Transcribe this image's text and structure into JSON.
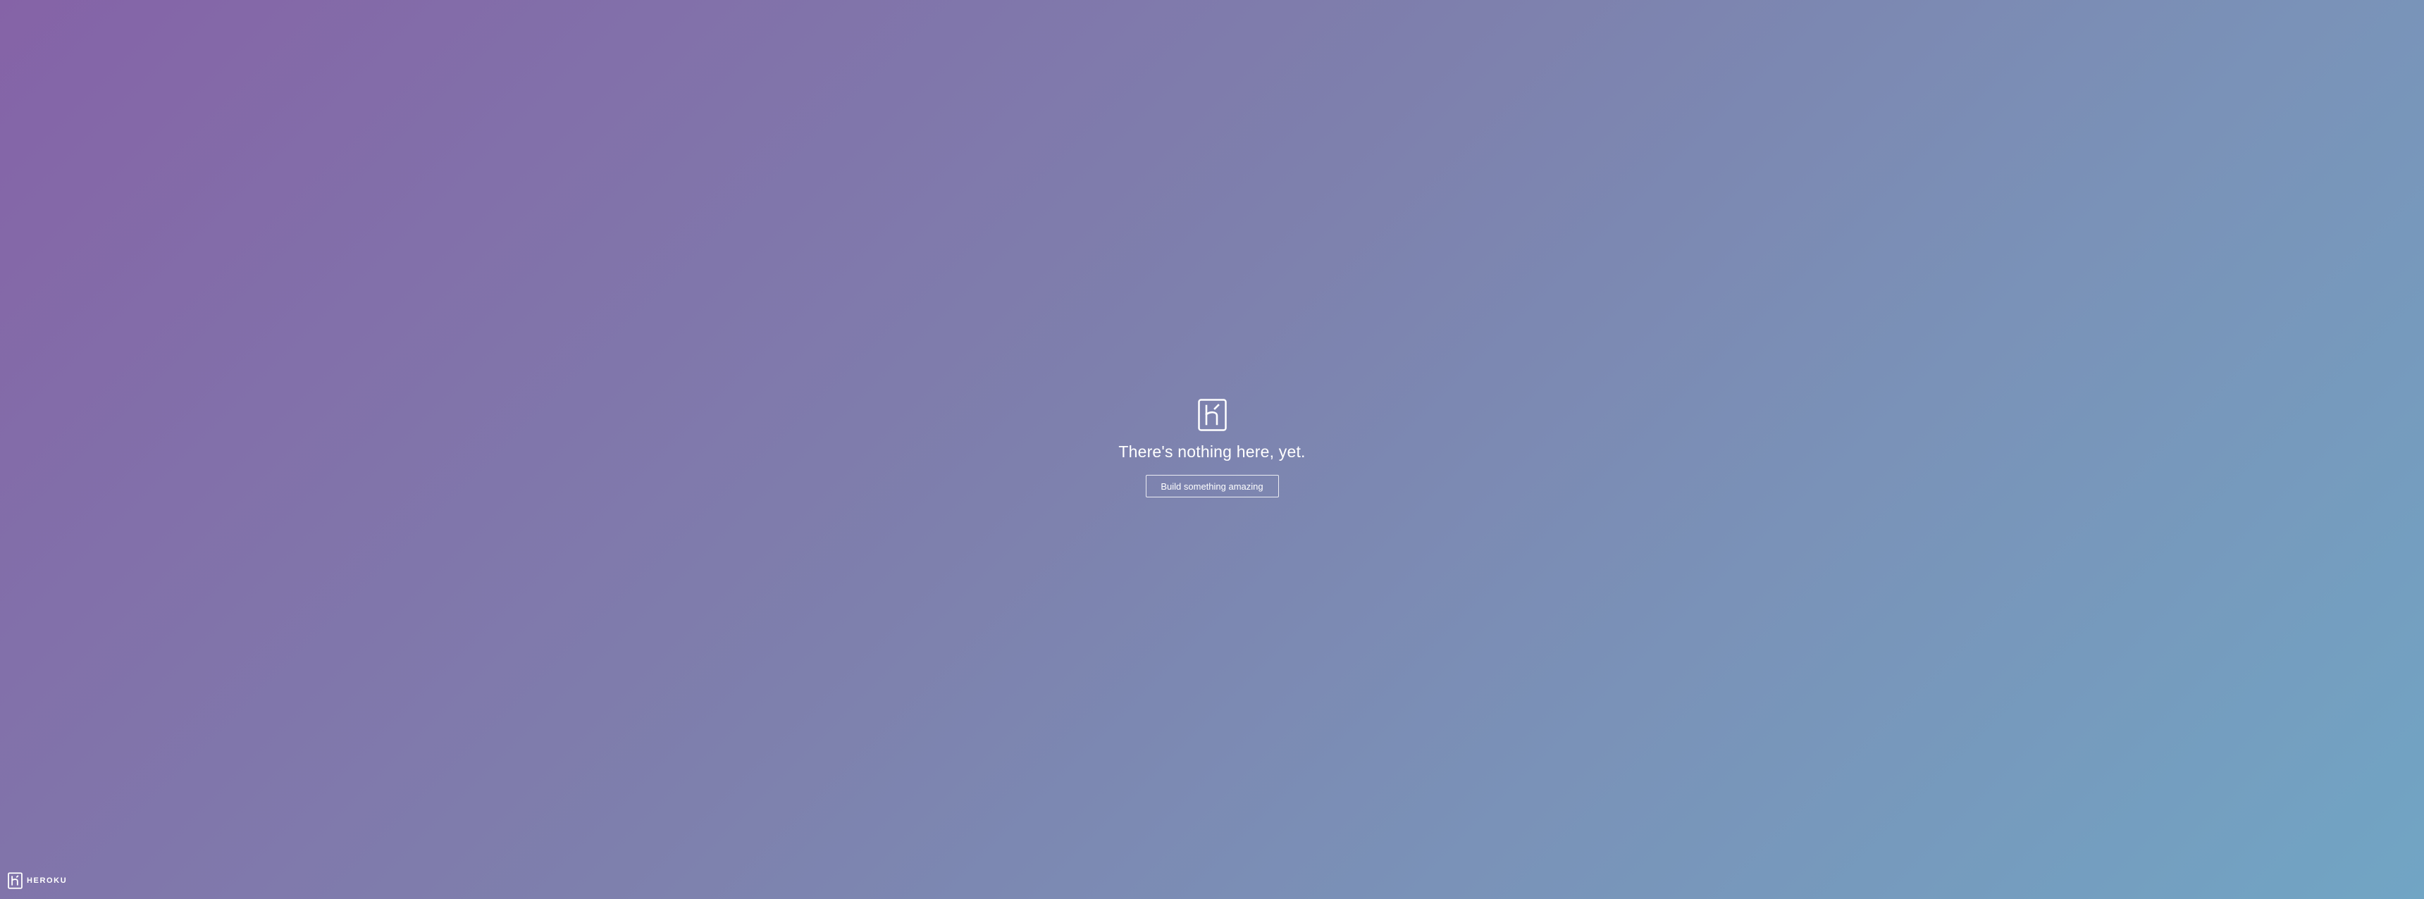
{
  "page": {
    "headline": "There's nothing here, yet.",
    "cta_label": "Build something amazing"
  },
  "footer": {
    "brand_name": "HEROKU"
  },
  "icons": {
    "main_logo": "heroku-logo-icon",
    "footer_logo": "heroku-logo-icon"
  },
  "colors": {
    "gradient_start": "#8563a7",
    "gradient_end": "#71a5c4",
    "text": "#ffffff"
  }
}
